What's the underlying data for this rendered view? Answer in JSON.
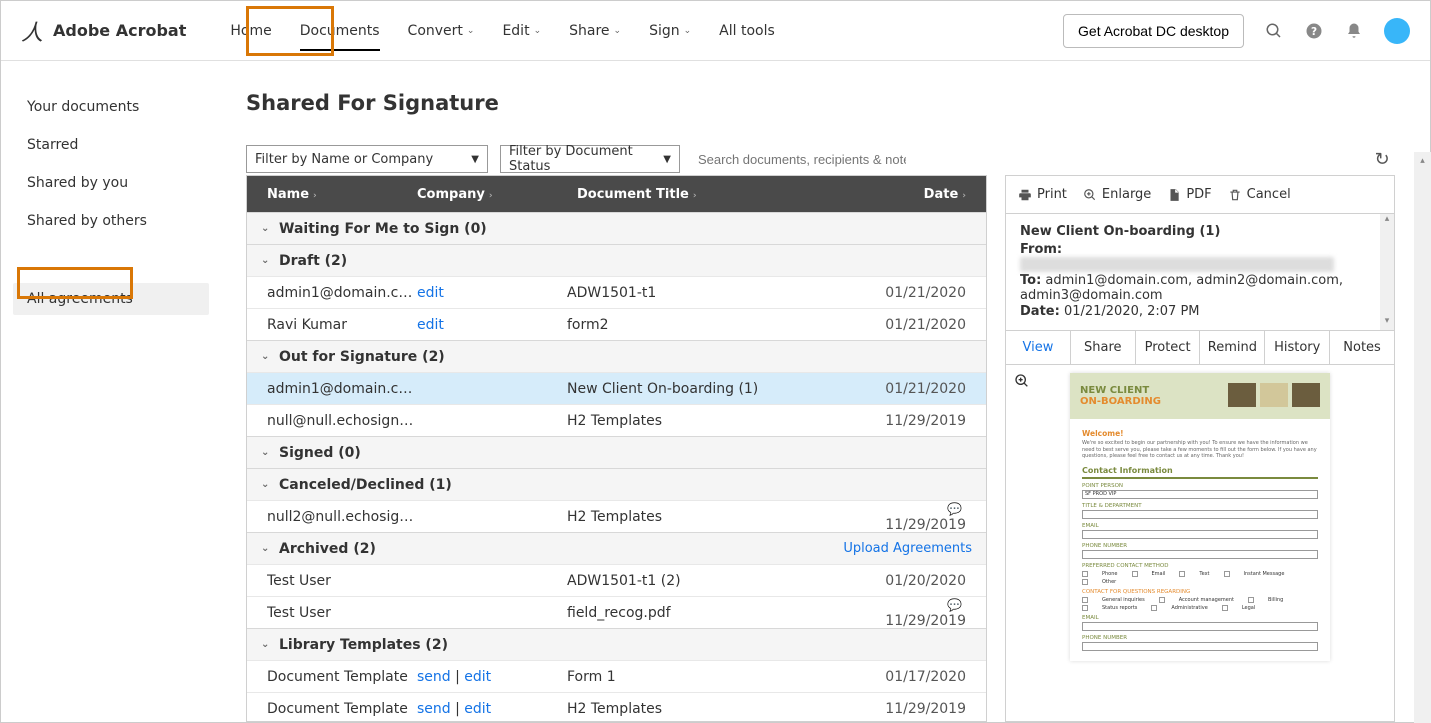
{
  "header": {
    "product": "Adobe Acrobat",
    "nav": [
      "Home",
      "Documents",
      "Convert",
      "Edit",
      "Share",
      "Sign",
      "All tools"
    ],
    "nav_has_caret": [
      false,
      false,
      true,
      true,
      true,
      true,
      false
    ],
    "selected_nav_index": 1,
    "desktop_btn": "Get Acrobat DC desktop"
  },
  "sidebar": {
    "items": [
      "Your documents",
      "Starred",
      "Shared by you",
      "Shared by others"
    ],
    "agreements": "All agreements"
  },
  "page": {
    "title": "Shared For Signature",
    "filter_name": "Filter by Name or Company",
    "filter_status": "Filter by Document Status",
    "search_placeholder": "Search documents, recipients & notes"
  },
  "columns": {
    "name": "Name",
    "company": "Company",
    "title": "Document Title",
    "date": "Date"
  },
  "groups": [
    {
      "label": "Waiting For Me to Sign (0)",
      "rows": []
    },
    {
      "label": "Draft (2)",
      "rows": [
        {
          "name": "admin1@domain.com",
          "company_link": "edit",
          "title": "ADW1501-t1",
          "date": "01/21/2020"
        },
        {
          "name": "Ravi Kumar",
          "company_link": "edit",
          "title": "form2",
          "date": "01/21/2020"
        }
      ]
    },
    {
      "label": "Out for Signature (2)",
      "rows": [
        {
          "name": "admin1@domain.com",
          "title": "New Client On-boarding (1)",
          "date": "01/21/2020",
          "selected": true
        },
        {
          "name": "null@null.echosignmail.c...",
          "title": "H2 Templates",
          "date": "11/29/2019"
        }
      ]
    },
    {
      "label": "Signed (0)",
      "rows": []
    },
    {
      "label": "Canceled/Declined (1)",
      "rows": [
        {
          "name": "null2@null.echosignmail....",
          "title": "H2 Templates",
          "date": "11/29/2019",
          "chat": true
        }
      ]
    },
    {
      "label": "Archived (2)",
      "upload": "Upload Agreements",
      "rows": [
        {
          "name": "Test User",
          "title": "ADW1501-t1 (2)",
          "date": "01/20/2020"
        },
        {
          "name": "Test User",
          "title": "field_recog.pdf",
          "date": "11/29/2019",
          "chat": true
        }
      ]
    },
    {
      "label": "Library Templates (2)",
      "rows": [
        {
          "name": "Document Template",
          "company_text": "send | edit",
          "title": "Form 1",
          "date": "01/17/2020"
        },
        {
          "name": "Document Template",
          "company_text": "send | edit",
          "title": "H2 Templates",
          "date": "11/29/2019"
        }
      ]
    }
  ],
  "detail": {
    "tools": {
      "print": "Print",
      "enlarge": "Enlarge",
      "pdf": "PDF",
      "cancel": "Cancel"
    },
    "meta": {
      "title": "New Client On-boarding (1)",
      "from_label": "From:",
      "to_label": "To:",
      "to": "admin1@domain.com, admin2@domain.com, admin3@domain.com",
      "date_label": "Date:",
      "date": "01/21/2020, 2:07 PM"
    },
    "tabs": [
      "View",
      "Share",
      "Protect",
      "Remind",
      "History",
      "Notes"
    ],
    "active_tab_index": 0,
    "preview": {
      "header_line1": "NEW CLIENT",
      "header_line2": "ON-BOARDING",
      "welcome": "Welcome!",
      "para": "We're so excited to begin our partnership with you! To ensure we have the information we need to best serve you, please take a few moments to fill out the form below. If you have any questions, please feel free to contact us at any time. Thank you!",
      "section_contact": "Contact Information",
      "labels": {
        "point": "POINT PERSON",
        "point_val": "SF PROD VIP",
        "title_dept": "TITLE & DEPARTMENT",
        "email": "EMAIL",
        "phone": "PHONE NUMBER",
        "pref": "PREFERRED CONTACT METHOD",
        "chk_phone": "Phone",
        "chk_email": "Email",
        "chk_text": "Text",
        "chk_im": "Instant Message",
        "chk_other": "Other",
        "contact_q": "CONTACT FOR QUESTIONS REGARDING",
        "chk_gi": "General inquiries",
        "chk_am": "Account management",
        "chk_bill": "Billing",
        "chk_sr": "Status reports",
        "chk_admin": "Administrative",
        "chk_legal": "Legal",
        "email2": "EMAIL",
        "phone2": "PHONE NUMBER"
      }
    }
  }
}
